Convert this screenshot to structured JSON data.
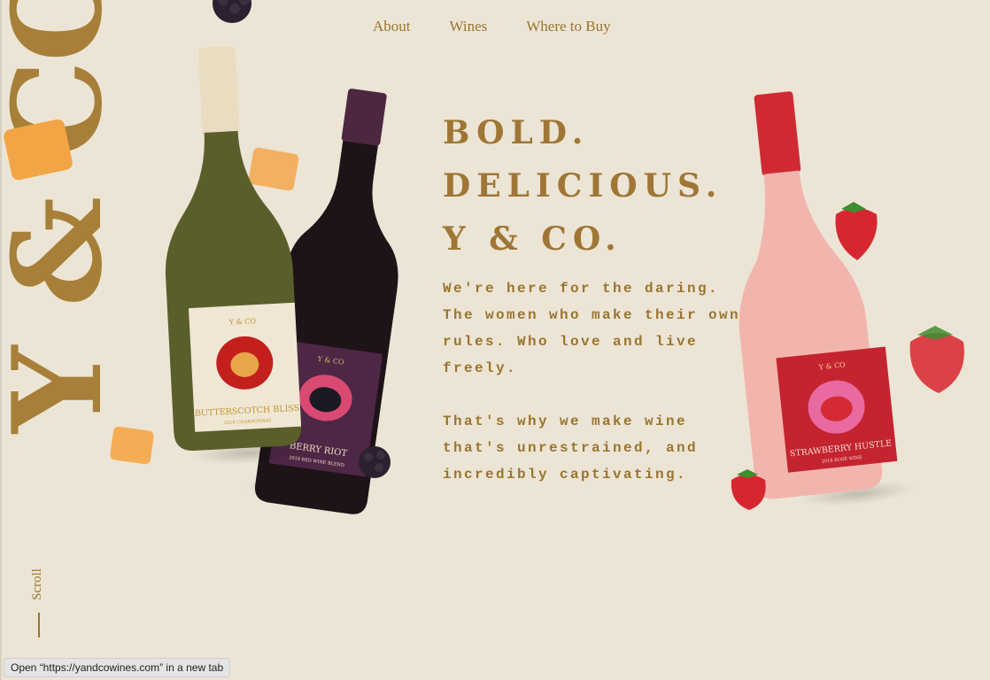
{
  "brand": {
    "logo_text": "Y & CO"
  },
  "nav": {
    "items": [
      "About",
      "Wines",
      "Where to Buy"
    ]
  },
  "hero": {
    "headline": [
      "BOLD.",
      "DELICIOUS.",
      "Y & CO."
    ],
    "paragraphs": [
      "We're here for the daring. The women who make their own rules. Who love and live freely.",
      "That's why we make wine that's unrestrained, and incredibly captivating."
    ]
  },
  "products": [
    {
      "brand_mark": "Y & CO",
      "name": "BUTTERSCOTCH BLISS",
      "sub": "2018 CHARDONNAY",
      "label_color": "#efe7d4",
      "bottle_color": "#5a5e2b"
    },
    {
      "brand_mark": "Y & CO",
      "name": "BERRY RIOT",
      "sub": "2018 RED WINE BLEND",
      "label_color": "#4e2745",
      "bottle_color": "#1e1317"
    },
    {
      "brand_mark": "Y & CO",
      "name": "STRAWBERRY HUSTLE",
      "sub": "2018 ROSÉ WINE",
      "label_color": "#c4242f",
      "bottle_color": "#f2b5ad"
    }
  ],
  "scroll": {
    "label": "Scroll"
  },
  "status_bar": {
    "text": "Open “https://yandcowines.com” in a new tab"
  },
  "colors": {
    "background": "#ece5d5",
    "gold": "#9a7430",
    "logo": "#a77f39"
  }
}
